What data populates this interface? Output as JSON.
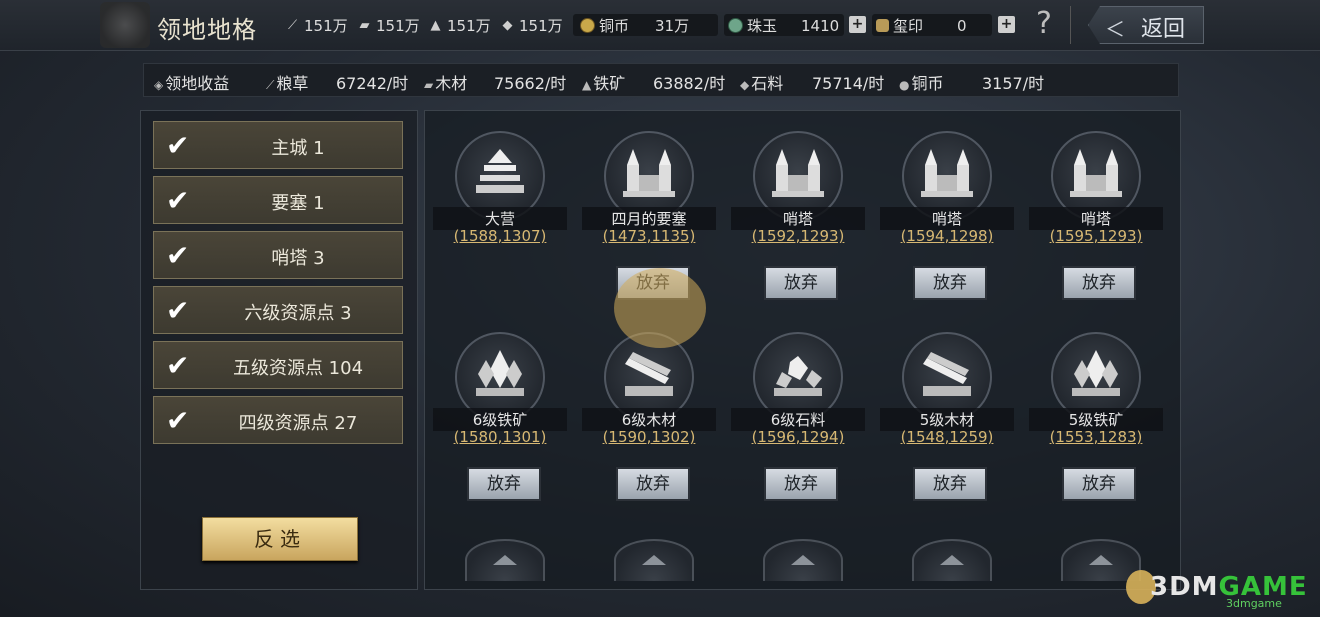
{
  "header": {
    "title": "领地地格",
    "resources": [
      {
        "icon": "grain-icon",
        "value": "151万"
      },
      {
        "icon": "wood-icon",
        "value": "151万"
      },
      {
        "icon": "iron-icon",
        "value": "151万"
      },
      {
        "icon": "stone-icon",
        "value": "151万"
      }
    ],
    "copper": {
      "label": "铜币",
      "value": "31万"
    },
    "jade": {
      "label": "珠玉",
      "value": "1410"
    },
    "seal": {
      "label": "玺印",
      "value": "0"
    },
    "plus": "+",
    "help": "?",
    "back_chevron": "＜",
    "back_label": "返回"
  },
  "income": {
    "label": "领地收益",
    "items": [
      {
        "icon": "grain-icon",
        "label": "粮草",
        "value": "67242/时"
      },
      {
        "icon": "wood-icon",
        "label": "木材",
        "value": "75662/时"
      },
      {
        "icon": "iron-icon",
        "label": "铁矿",
        "value": "63882/时"
      },
      {
        "icon": "stone-icon",
        "label": "石料",
        "value": "75714/时"
      },
      {
        "icon": "copper-icon",
        "label": "铜币",
        "value": "3157/时"
      }
    ]
  },
  "filters": [
    {
      "label": "主城    1",
      "checked": true
    },
    {
      "label": "要塞    1",
      "checked": true
    },
    {
      "label": "哨塔    3",
      "checked": true
    },
    {
      "label": "六级资源点 3",
      "checked": true
    },
    {
      "label": "五级资源点 104",
      "checked": true
    },
    {
      "label": "四级资源点 27",
      "checked": true
    }
  ],
  "checkmark": "✔",
  "invert_label": "反选",
  "tiles": [
    {
      "name": "大营",
      "coord": "(1588,1307)",
      "icon": "camp-icon",
      "abandon": null
    },
    {
      "name": "四月的要塞",
      "coord": "(1473,1135)",
      "icon": "fortress-icon",
      "abandon": "放弃"
    },
    {
      "name": "哨塔",
      "coord": "(1592,1293)",
      "icon": "watchtower-icon",
      "abandon": "放弃"
    },
    {
      "name": "哨塔",
      "coord": "(1594,1298)",
      "icon": "watchtower-icon",
      "abandon": "放弃"
    },
    {
      "name": "哨塔",
      "coord": "(1595,1293)",
      "icon": "watchtower-icon",
      "abandon": "放弃"
    },
    {
      "name": "6级铁矿",
      "coord": "(1580,1301)",
      "icon": "iron-crystal-icon",
      "abandon": "放弃"
    },
    {
      "name": "6级木材",
      "coord": "(1590,1302)",
      "icon": "lumber-icon",
      "abandon": "放弃"
    },
    {
      "name": "6级石料",
      "coord": "(1596,1294)",
      "icon": "stone-pile-icon",
      "abandon": "放弃"
    },
    {
      "name": "5级木材",
      "coord": "(1548,1259)",
      "icon": "lumber-icon",
      "abandon": "放弃"
    },
    {
      "name": "5级铁矿",
      "coord": "(1553,1283)",
      "icon": "iron-crystal-icon",
      "abandon": "放弃"
    }
  ],
  "watermark": {
    "brand_a": "3DM",
    "brand_b": "GAME",
    "sub": "3dmgame"
  }
}
